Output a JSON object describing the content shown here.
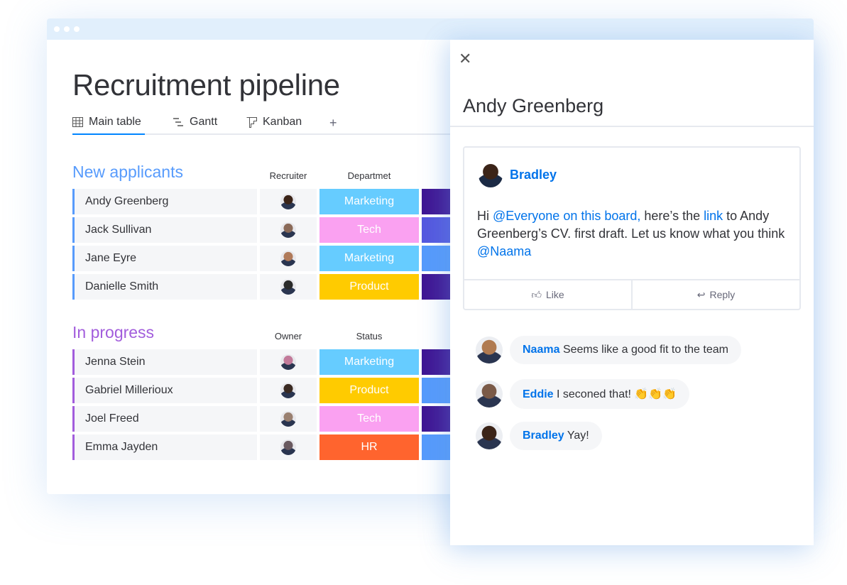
{
  "board": {
    "title": "Recruitment pipeline",
    "tabs": [
      {
        "label": "Main table",
        "icon": "table-icon"
      },
      {
        "label": "Gantt",
        "icon": "gantt-icon"
      },
      {
        "label": "Kanban",
        "icon": "kanban-icon"
      }
    ],
    "add_tab": "+",
    "groups": [
      {
        "title": "New applicants",
        "color": "#579bfc",
        "col1": "Recruiter",
        "col2": "Departmet",
        "rows": [
          {
            "name": "Andy Greenberg",
            "status": "Marketing",
            "status_color": "#66ccff",
            "extra_color": "#401694",
            "avatar_color": "#3b2418"
          },
          {
            "name": "Jack Sullivan",
            "status": "Tech",
            "status_color": "#faa1f1",
            "extra_color": "#5559df",
            "avatar_color": "#8a6a58"
          },
          {
            "name": "Jane Eyre",
            "status": "Marketing",
            "status_color": "#66ccff",
            "extra_color": "#579bfc",
            "avatar_color": "#b07a5a"
          },
          {
            "name": "Danielle Smith",
            "status": "Product",
            "status_color": "#ffcb00",
            "extra_color": "#401694",
            "avatar_color": "#2a2a2a"
          }
        ]
      },
      {
        "title": "In progress",
        "color": "#a25ddc",
        "col1": "Owner",
        "col2": "Status",
        "rows": [
          {
            "name": "Jenna Stein",
            "status": "Marketing",
            "status_color": "#66ccff",
            "extra_color": "#401694",
            "avatar_color": "#c27a9a"
          },
          {
            "name": "Gabriel Millerioux",
            "status": "Product",
            "status_color": "#ffcb00",
            "extra_color": "#579bfc",
            "avatar_color": "#3a2a22"
          },
          {
            "name": "Joel Freed",
            "status": "Tech",
            "status_color": "#faa1f1",
            "extra_color": "#401694",
            "avatar_color": "#9a8070"
          },
          {
            "name": "Emma Jayden",
            "status": "HR",
            "status_color": "#ff642e",
            "extra_color": "#579bfc",
            "avatar_color": "#6a5a60"
          }
        ]
      }
    ]
  },
  "panel": {
    "title": "Andy Greenberg",
    "post": {
      "author": "Bradley",
      "parts": [
        "Hi ",
        "@Everyone on this board,",
        " here’s the ",
        "link",
        " to Andy Greenberg’s CV. first draft. Let us know what you think ",
        "@Naama"
      ],
      "like": "Like",
      "reply": "Reply"
    },
    "comments": [
      {
        "author": "Naama",
        "text": "Seems like a good fit to the team",
        "avatar_color": "#b07a50"
      },
      {
        "author": "Eddie",
        "text": "I seconed that!  👏👏👏",
        "avatar_color": "#7a5a48"
      },
      {
        "author": "Bradley",
        "text": "Yay!",
        "avatar_color": "#3b2418"
      }
    ]
  },
  "colors": {
    "accent": "#0073ea"
  }
}
